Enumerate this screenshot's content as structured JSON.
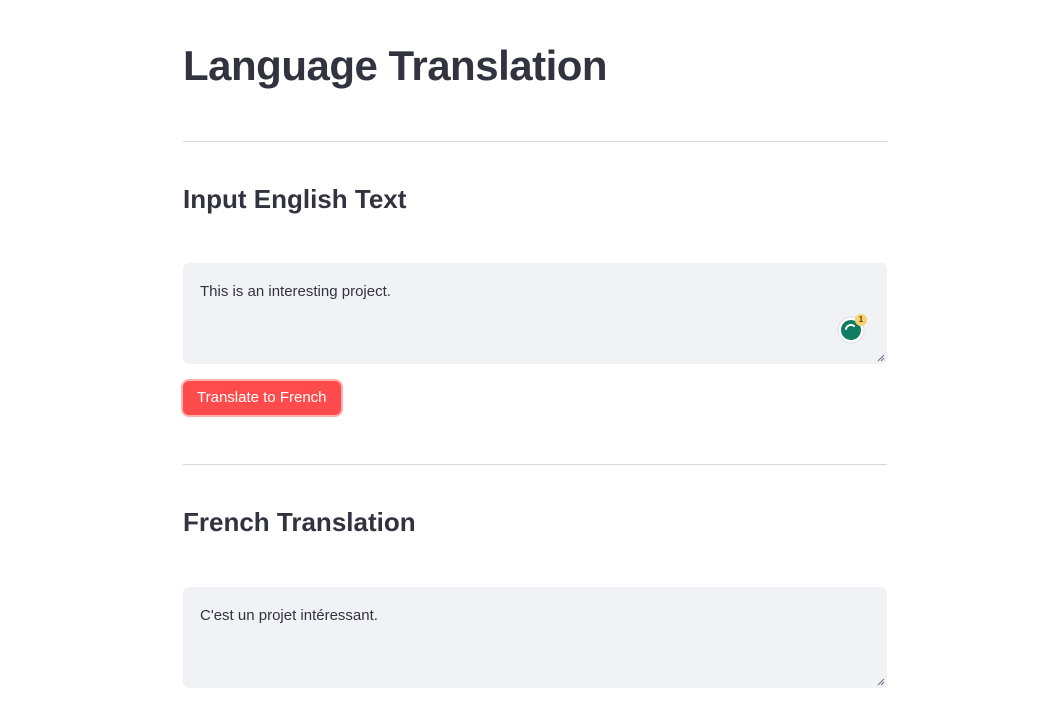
{
  "page": {
    "title": "Language Translation"
  },
  "input_section": {
    "heading": "Input English Text",
    "text_value": "This is an interesting project.",
    "grammar_badge_count": "1"
  },
  "translate_button": {
    "label": "Translate to French"
  },
  "output_section": {
    "heading": "French Translation",
    "text_value": "C'est un projet intéressant."
  },
  "colors": {
    "accent": "#ff4b4b",
    "text": "#31333f",
    "field_background": "#f0f2f6",
    "divider": "#d6d6d9",
    "grammar_icon": "#0f7d63"
  }
}
